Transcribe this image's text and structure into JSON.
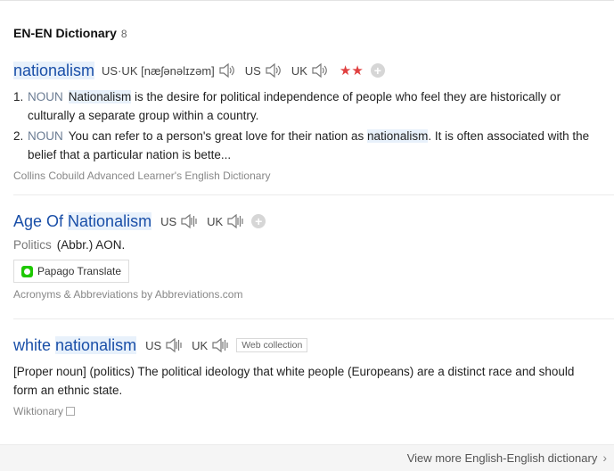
{
  "header": {
    "title": "EN-EN Dictionary",
    "count": "8"
  },
  "entry1": {
    "headword": "nationalism",
    "phonetic": "US·UK [næʃənəlɪzəm]",
    "us_label": "US",
    "uk_label": "UK",
    "stars": "★★",
    "defs": [
      {
        "num": "1.",
        "pos": "NOUN",
        "hl": "Nationalism",
        "rest": " is the desire for political independence of people who feel they are historically or culturally a separate group within a country."
      },
      {
        "num": "2.",
        "pos": "NOUN",
        "pre": "You can refer to a person's great love for their nation as ",
        "hl": "nationalism",
        "post": ". It is often associated with the belief that a particular nation is bette..."
      }
    ],
    "source": "Collins Cobuild Advanced Learner's English Dictionary"
  },
  "entry2": {
    "headword_a": "Age Of ",
    "headword_b": "Nationalism",
    "us_label": "US",
    "uk_label": "UK",
    "domain": "Politics",
    "abbr": "(Abbr.) AON.",
    "papago": "Papago Translate",
    "source": "Acronyms & Abbreviations by Abbreviations.com"
  },
  "entry3": {
    "headword_a": "white ",
    "headword_b": "nationalism",
    "us_label": "US",
    "uk_label": "UK",
    "tag": "Web collection",
    "desc": "[Proper noun] (politics) The political ideology that white people (Europeans) are a distinct race and should form an ethnic state.",
    "source": "Wiktionary"
  },
  "footer": {
    "more": "View more English-English dictionary"
  },
  "colors": {
    "headword": "#1a4fa8",
    "highlight": "#e8f1fb",
    "stars": "#e04040",
    "pos": "#6b7c93"
  },
  "icons": [
    "speaker-icon",
    "plus-icon",
    "papago-icon",
    "chevron-right-icon",
    "external-box-icon"
  ]
}
